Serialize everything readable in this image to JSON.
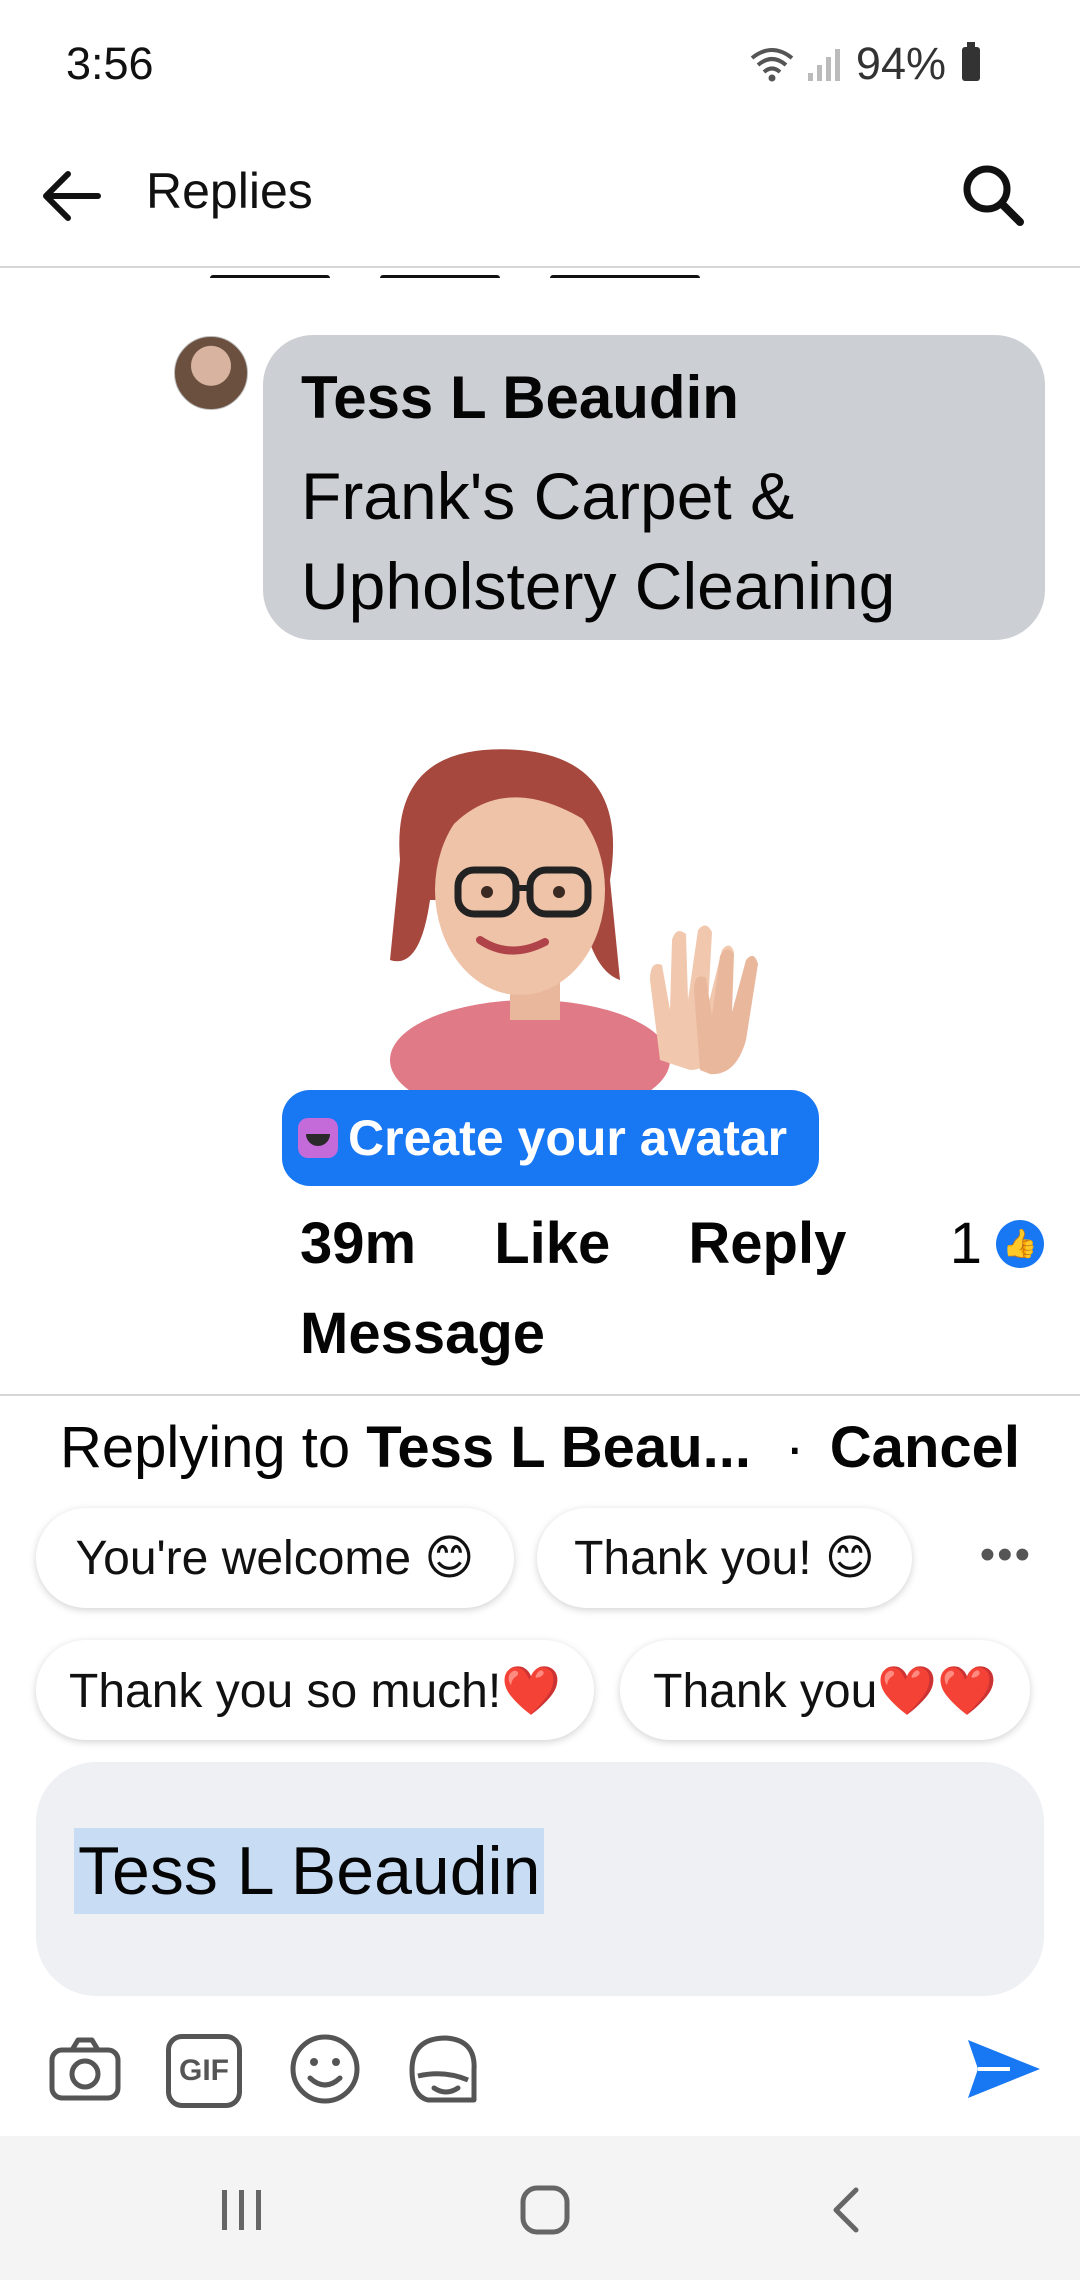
{
  "status": {
    "time": "3:56",
    "battery": "94%"
  },
  "header": {
    "title": "Replies"
  },
  "comment": {
    "author": "Tess L Beaudin",
    "text": "Frank's Carpet & Upholstery Cleaning",
    "create_avatar_label": "Create your avatar",
    "time": "39m",
    "like_label": "Like",
    "reply_label": "Reply",
    "message_label": "Message",
    "like_count": "1"
  },
  "replying": {
    "prefix": "Replying to",
    "name": "Tess L Beau...",
    "separator": "·",
    "cancel_label": "Cancel"
  },
  "suggestions": [
    {
      "label": "You're welcome 😊"
    },
    {
      "label": "Thank you! 😊"
    },
    {
      "label": "Thank you so much!❤️"
    },
    {
      "label": "Thank you❤️❤️"
    }
  ],
  "more_label": "•••",
  "composer": {
    "value": "Tess L Beaudin"
  },
  "toolbar": {
    "gif_label": "GIF"
  },
  "colors": {
    "accent": "#1877f2",
    "bubble": "#cccfd4",
    "composer_bg": "#eef0f4"
  },
  "icons": [
    "back-arrow-icon",
    "search-icon",
    "camera-icon",
    "gif-icon",
    "emoji-icon",
    "avatar-sticker-icon",
    "send-icon",
    "like-icon",
    "recents-icon",
    "home-icon",
    "nav-back-icon"
  ]
}
